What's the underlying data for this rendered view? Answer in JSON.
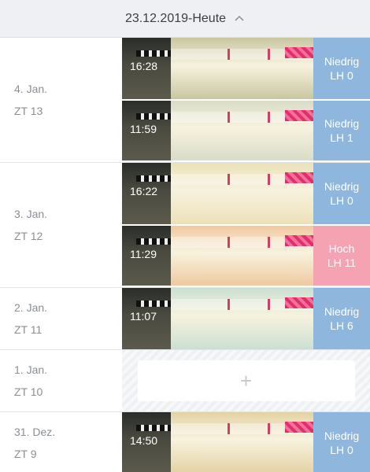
{
  "header": {
    "title": "23.12.2019-Heute",
    "icon": "chevron-up-icon"
  },
  "days": [
    {
      "date": "4. Jan.",
      "cycle_day": "ZT 13",
      "entries": [
        {
          "time": "16:28",
          "status": "Niedrig",
          "lh": "LH 0",
          "level": "low",
          "tone": "#c9c7a0"
        },
        {
          "time": "11:59",
          "status": "Niedrig",
          "lh": "LH 1",
          "level": "low",
          "tone": "#d9dcc8"
        }
      ]
    },
    {
      "date": "3. Jan.",
      "cycle_day": "ZT 12",
      "entries": [
        {
          "time": "16:22",
          "status": "Niedrig",
          "lh": "LH 0",
          "level": "low",
          "tone": "#ece1b8"
        },
        {
          "time": "11:29",
          "status": "Hoch",
          "lh": "LH 11",
          "level": "high",
          "tone": "#f0c9a0"
        }
      ]
    },
    {
      "date": "2. Jan.",
      "cycle_day": "ZT 11",
      "entries": [
        {
          "time": "11:07",
          "status": "Niedrig",
          "lh": "LH 6",
          "level": "low",
          "tone": "#cbe0d2"
        }
      ]
    },
    {
      "date": "1. Jan.",
      "cycle_day": "ZT 10",
      "entries": [],
      "add_label": "+"
    },
    {
      "date": "31. Dez.",
      "cycle_day": "ZT 9",
      "entries": [
        {
          "time": "14:50",
          "status": "Niedrig",
          "lh": "LH 0",
          "level": "low",
          "tone": "#e4d2a4"
        }
      ]
    }
  ]
}
